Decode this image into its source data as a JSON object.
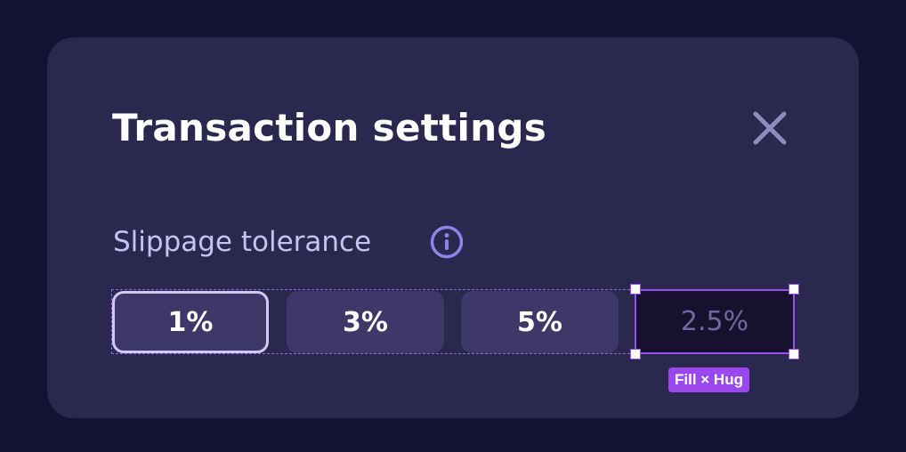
{
  "dialog": {
    "title": "Transaction settings",
    "close_icon": "close-icon"
  },
  "slippage": {
    "label": "Slippage tolerance",
    "info_icon": "info-icon",
    "options": [
      {
        "label": "1%",
        "selected": true
      },
      {
        "label": "3%",
        "selected": false
      },
      {
        "label": "5%",
        "selected": false
      }
    ],
    "custom_placeholder": "2.5%"
  },
  "design_overlay": {
    "size_badge": "Fill × Hug"
  },
  "colors": {
    "background": "#141233",
    "panel": "#2a284e",
    "option_bg": "#3e3868",
    "selected_border": "#d2c8f5",
    "accent_purple": "#9450f0",
    "info_icon": "#8b84ea"
  }
}
